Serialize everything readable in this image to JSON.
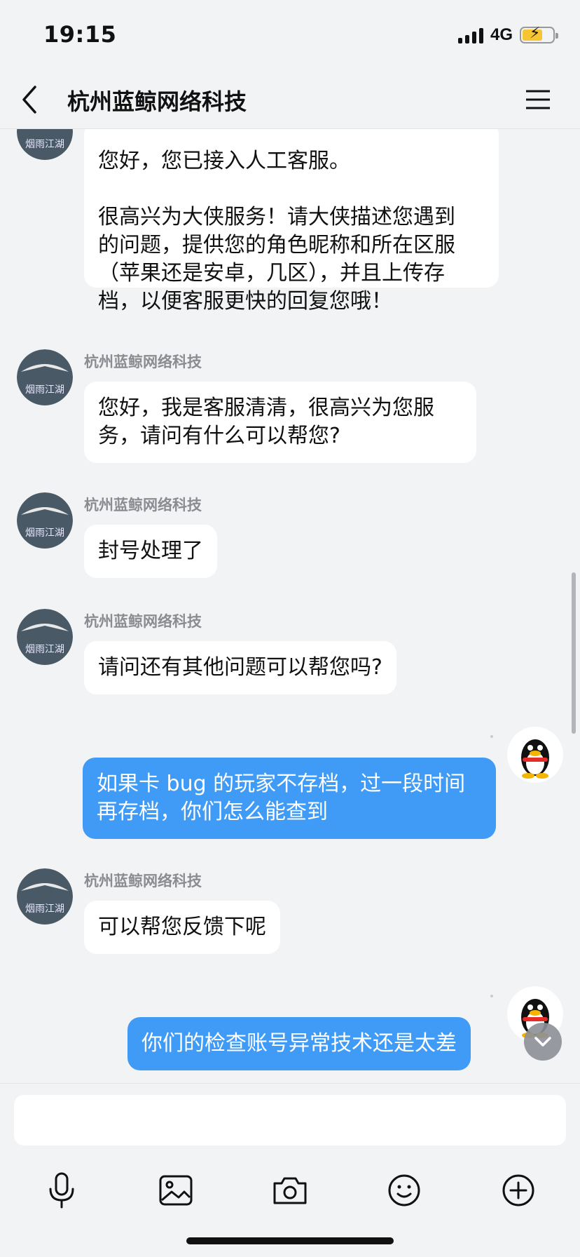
{
  "status_bar": {
    "time": "19:15",
    "network": "4G"
  },
  "nav": {
    "title": "杭州蓝鲸网络科技"
  },
  "avatars": {
    "service_caption": "烟雨江湖"
  },
  "messages": [
    {
      "from": "service",
      "sender": "",
      "lines": [
        "您好，您已接入人工客服。",
        "",
        "很高兴为大侠服务！请大侠描述您遇到",
        "的问题，提供您的角色昵称和所在区服",
        "（苹果还是安卓，几区），并且上传存",
        "档，以便客服更快的回复您哦！"
      ]
    },
    {
      "from": "service",
      "sender": "杭州蓝鲸网络科技",
      "lines": [
        "您好，我是客服清清，很高兴为您服",
        "务，请问有什么可以帮您?"
      ]
    },
    {
      "from": "service",
      "sender": "杭州蓝鲸网络科技",
      "lines": [
        "封号处理了"
      ]
    },
    {
      "from": "service",
      "sender": "杭州蓝鲸网络科技",
      "lines": [
        "请问还有其他问题可以帮您吗?"
      ]
    },
    {
      "from": "me",
      "sender": "",
      "lines": [
        "如果卡 bug 的玩家不存档，过一段时间",
        "再存档，你们怎么能查到"
      ]
    },
    {
      "from": "service",
      "sender": "杭州蓝鲸网络科技",
      "lines": [
        "可以帮您反馈下呢"
      ]
    },
    {
      "from": "me",
      "sender": "",
      "lines": [
        "你们的检查账号异常技术还是太差"
      ]
    }
  ],
  "toolbar": {
    "items": [
      "microphone-icon",
      "image-icon",
      "camera-icon",
      "emoji-icon",
      "plus-icon"
    ]
  },
  "colors": {
    "accent": "#3f9bf6",
    "background": "#f2f3f5",
    "bubble": "#ffffff"
  }
}
